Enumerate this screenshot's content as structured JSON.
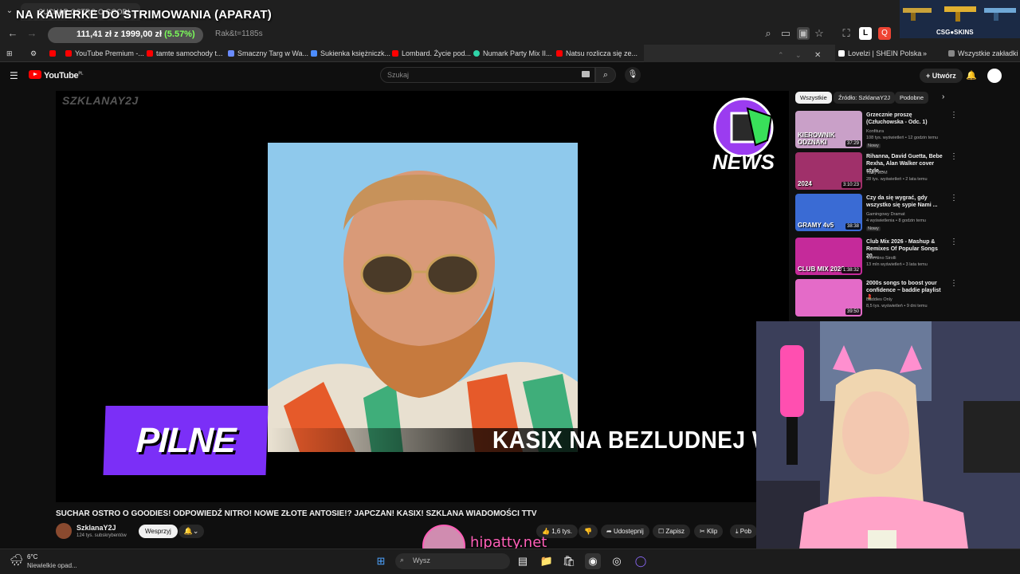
{
  "overlay": {
    "stream_title": "NA KAMERKE DO STRIMOWANIA (APARAT)",
    "hipatty_text": "hipatty.net",
    "csgo_label": "CSG●SKINS"
  },
  "browser": {
    "active_tab_label": "SUCHAR OSTRO O GOODI",
    "url_fragment": "Rak&t=1185s",
    "price_widget": {
      "price": "111,41 zł",
      "target": "z 1999,00 zł",
      "percent": "(5.57%)"
    },
    "bookmarks": [
      {
        "label": "YouTube Premium -...",
        "color": "#ff0000"
      },
      {
        "label": "tamte samochody t...",
        "color": "#ff0000"
      },
      {
        "label": "Smaczny Targ w Wa...",
        "color": "#6a8cff"
      },
      {
        "label": "Sukienka księżniczk...",
        "color": "#4d8dff"
      },
      {
        "label": "Lombard. Życie pod...",
        "color": "#ff0000"
      },
      {
        "label": "Numark Party Mix II...",
        "color": "#2fd4a8"
      },
      {
        "label": "Natsu rozlicza się ze...",
        "color": "#ff0000"
      },
      {
        "label": "Lovelzi | SHEIN Polska",
        "color": "#ffffff"
      }
    ],
    "all_bookmarks_label": "Wszystkie zakładki"
  },
  "youtube": {
    "logo_text": "YouTube",
    "logo_region": "PL",
    "search_placeholder": "Szukaj",
    "create_label": "Utwórz",
    "video": {
      "watermark": "SZKLANAY2J",
      "news_label": "NEWS",
      "pilne_label": "PILNE",
      "ticker_text": "KASIX NA BEZLUDNEJ WYS",
      "title": "SUCHAR OSTRO O GOODIES! ODPOWIEDŹ NITRO! NOWE ZŁOTE ANTOSIE!? JAPCZAN! KASIX! SZKLANA WIADOMOŚCI TTV"
    },
    "channel": {
      "name": "SzklanaY2J",
      "subscribers": "124 tys. subskrybentów",
      "support_label": "Wesprzyj"
    },
    "actions": {
      "likes": "1,6 tys.",
      "share": "Udostępnij",
      "save": "Zapisz",
      "clip": "Klip",
      "download": "Pob"
    },
    "chips": [
      "Wszystkie",
      "Źródło: SzklanaY2J",
      "Podobne"
    ],
    "recommendations": [
      {
        "title": "Grzecznie proszę (Człuchowska - Odc. 1)",
        "channel": "Konfitura",
        "meta": "108 tys. wyświetleń • 12 godzin temu",
        "badge": "Nowy",
        "duration": "37:29",
        "thumb_color": "#c9a0c8"
      },
      {
        "title": "Rihanna, David Guetta, Bebe Rexha, Alan Walker cover style...",
        "channel": "Tasty EDM",
        "meta": "28 tys. wyświetleń • 2 lata temu",
        "badge": "",
        "duration": "3:10:23",
        "thumb_color": "#a0306a"
      },
      {
        "title": "Czy da się wygrać, gdy wszystko się sypie  Nami ...",
        "channel": "Gamingowy Dramat",
        "meta": "4 wyświetlenia • 8 godzin temu",
        "badge": "Nowy",
        "duration": "38:38",
        "thumb_color": "#3a6bd4"
      },
      {
        "title": "Club Mix 2026 - Mashup & Remixes Of Popular Songs 20...",
        "channel": "Valentino Sirolli",
        "meta": "13 mln wyświetleń • 3 lata temu",
        "badge": "",
        "duration": "1:38:32",
        "thumb_color": "#c52a9a"
      },
      {
        "title": "2000s songs to boost your confidence ~ baddie playlist 💄",
        "channel": "Baddies Only",
        "meta": "8,5 tys. wyświetleń • 9 dni temu",
        "badge": "",
        "duration": "39:50",
        "thumb_color": "#e46bc8"
      }
    ],
    "rec_thumb_labels": [
      "KIEROWNIK ODZNAKI",
      "2024",
      "GRAMY 4v5",
      "CLUB MIX 2026",
      ""
    ]
  },
  "taskbar": {
    "weather_temp": "6°C",
    "weather_desc": "Niewielkie opad...",
    "search_placeholder": "Wysz"
  }
}
